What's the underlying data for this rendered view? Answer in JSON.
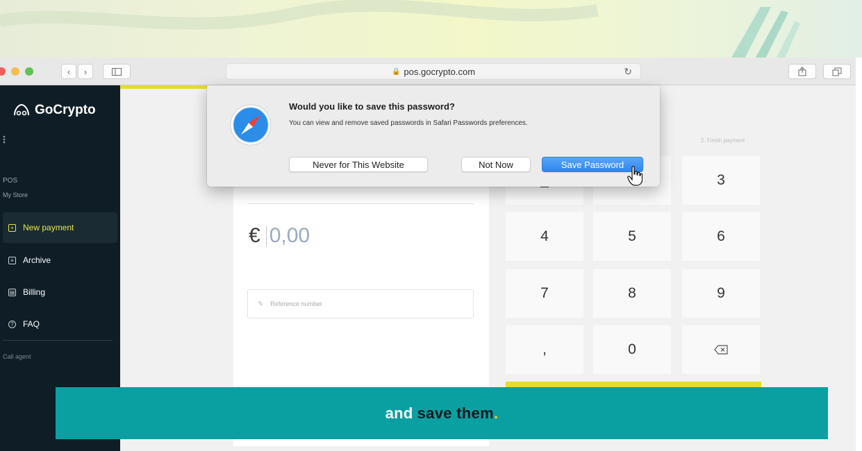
{
  "browser": {
    "url": "pos.gocrypto.com"
  },
  "sidebar": {
    "brand": "GoCrypto",
    "section_label": "POS",
    "store_label": "My Store",
    "items": [
      {
        "label": "New payment",
        "icon": "plus-square-icon",
        "active": true
      },
      {
        "label": "Archive",
        "icon": "archive-icon",
        "active": false
      },
      {
        "label": "Billing",
        "icon": "billing-icon",
        "active": false
      },
      {
        "label": "FAQ",
        "icon": "help-icon",
        "active": false
      }
    ],
    "call_agent": "Call agent"
  },
  "payment": {
    "currency": "€",
    "amount_placeholder": "0,00",
    "reference_placeholder": "Reference number",
    "step_label": "2. Finish payment"
  },
  "keypad": {
    "keys": [
      "3",
      "4",
      "5",
      "6",
      "7",
      "8",
      "9",
      ",",
      "0"
    ],
    "backspace_icon": "backspace-icon",
    "partial_key": "_"
  },
  "dialog": {
    "title": "Would you like to save this password?",
    "message": "You can view and remove saved passwords in Safari Passwords preferences.",
    "never_button": "Never for This Website",
    "not_now_button": "Not Now",
    "save_button": "Save Password"
  },
  "caption": {
    "part1": "and",
    "part2": "save them",
    "part3": "."
  },
  "colors": {
    "accent_yellow": "#e6dc2a",
    "sidebar_bg": "#0f1e26",
    "caption_bg": "#0aa0a1",
    "safari_blue": "#2f86ef"
  }
}
